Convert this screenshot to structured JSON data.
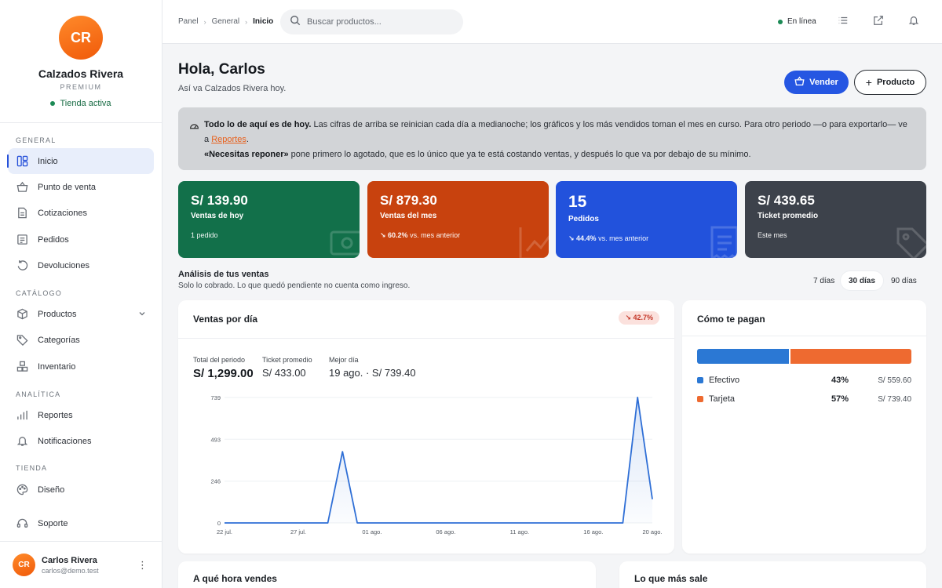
{
  "brand": {
    "initials": "CR",
    "name": "Calzados Rivera",
    "tier": "PREMIUM",
    "status": "Tienda activa"
  },
  "nav": {
    "general_label": "GENERAL",
    "catalog_label": "CATÁLOGO",
    "analytics_label": "ANALÍTICA",
    "store_label": "TIENDA",
    "items": {
      "inicio": "Inicio",
      "punto": "Punto de venta",
      "cotizaciones": "Cotizaciones",
      "pedidos": "Pedidos",
      "devoluciones": "Devoluciones",
      "productos": "Productos",
      "categorias": "Categorías",
      "inventario": "Inventario",
      "reportes": "Reportes",
      "notificaciones": "Notificaciones",
      "diseno": "Diseño",
      "soporte": "Soporte"
    }
  },
  "user": {
    "initials": "CR",
    "name": "Carlos Rivera",
    "email": "carlos@demo.test"
  },
  "topbar": {
    "crumbs": [
      "Panel",
      "General",
      "Inicio"
    ],
    "search_placeholder": "Buscar productos...",
    "online": "En línea"
  },
  "header": {
    "greeting": "Hola, Carlos",
    "subtitle": "Así va Calzados Rivera hoy.",
    "sell_label": "Vender",
    "product_label": "Producto"
  },
  "notice": {
    "bold1": "Todo lo de aquí es de hoy.",
    "text1": " Las cifras de arriba se reinician cada día a medianoche; los gráficos y los más vendidos toman el mes en curso. Para otro periodo —o para exportarlo— ve a ",
    "link": "Reportes",
    "text2": ".",
    "bold2": "«Necesitas reponer»",
    "text3": " pone primero lo agotado, que es lo único que ya te está costando ventas, y después lo que va por debajo de su mínimo."
  },
  "kpis": [
    {
      "value": "S/ 139.90",
      "label": "Ventas de hoy",
      "foot_strong": "",
      "foot": "1 pedido",
      "color": "#12704a"
    },
    {
      "value": "S/ 879.30",
      "label": "Ventas del mes",
      "foot_strong": "↘ 60.2%",
      "foot": " vs. mes anterior",
      "color": "#c8420e"
    },
    {
      "value": "15",
      "label": "Pedidos",
      "foot_strong": "↘ 44.4%",
      "foot": " vs. mes anterior",
      "color": "#2252dc"
    },
    {
      "value": "S/ 439.65",
      "label": "Ticket promedio",
      "foot_strong": "",
      "foot": "Este mes",
      "color": "#3d424b"
    }
  ],
  "analysis": {
    "title": "Análisis de tus ventas",
    "subtitle": "Solo lo cobrado. Lo que quedó pendiente no cuenta como ingreso.",
    "ranges": [
      "7 días",
      "30 días",
      "90 días"
    ],
    "active_range": "30 días"
  },
  "sales_card": {
    "title": "Ventas por día",
    "badge": "↘ 42.7%",
    "stats": [
      {
        "label": "Total del periodo",
        "value": "S/ 1,299.00"
      },
      {
        "label": "Ticket promedio",
        "value": "S/ 433.00"
      },
      {
        "label": "Mejor día",
        "value": "19 ago. · S/ 739.40"
      }
    ]
  },
  "chart_data": {
    "type": "area",
    "x": [
      "22 jul.",
      "23 jul.",
      "24 jul.",
      "25 jul.",
      "26 jul.",
      "27 jul.",
      "28 jul.",
      "29 jul.",
      "30 jul.",
      "31 jul.",
      "01 ago.",
      "02 ago.",
      "03 ago.",
      "04 ago.",
      "05 ago.",
      "06 ago.",
      "07 ago.",
      "08 ago.",
      "09 ago.",
      "10 ago.",
      "11 ago.",
      "12 ago.",
      "13 ago.",
      "14 ago.",
      "15 ago.",
      "16 ago.",
      "17 ago.",
      "18 ago.",
      "19 ago.",
      "20 ago."
    ],
    "series": [
      {
        "values": [
          0,
          0,
          0,
          0,
          0,
          0,
          0,
          0,
          419.7,
          0,
          0,
          0,
          0,
          0,
          0,
          0,
          0,
          0,
          0,
          0,
          0,
          0,
          0,
          0,
          0,
          0,
          0,
          0,
          739.4,
          139.9
        ]
      }
    ],
    "x_tick_labels": [
      "22 jul.",
      "27 jul.",
      "01 ago.",
      "06 ago.",
      "11 ago.",
      "16 ago.",
      "20 ago."
    ],
    "y_ticks": [
      "0",
      "246",
      "493",
      "739"
    ],
    "ylim": [
      0,
      739
    ],
    "grid": true,
    "color": "#2f6fd6"
  },
  "payments": {
    "title": "Cómo te pagan",
    "items": [
      {
        "name": "Efectivo",
        "pct": "43%",
        "share": 43,
        "amount": "S/ 559.60",
        "color": "#2b78d4"
      },
      {
        "name": "Tarjeta",
        "pct": "57%",
        "share": 57,
        "amount": "S/ 739.40",
        "color": "#ee6a30"
      }
    ]
  },
  "bottom": {
    "hours_title": "A qué hora vendes",
    "top_title": "Lo que más sale"
  }
}
